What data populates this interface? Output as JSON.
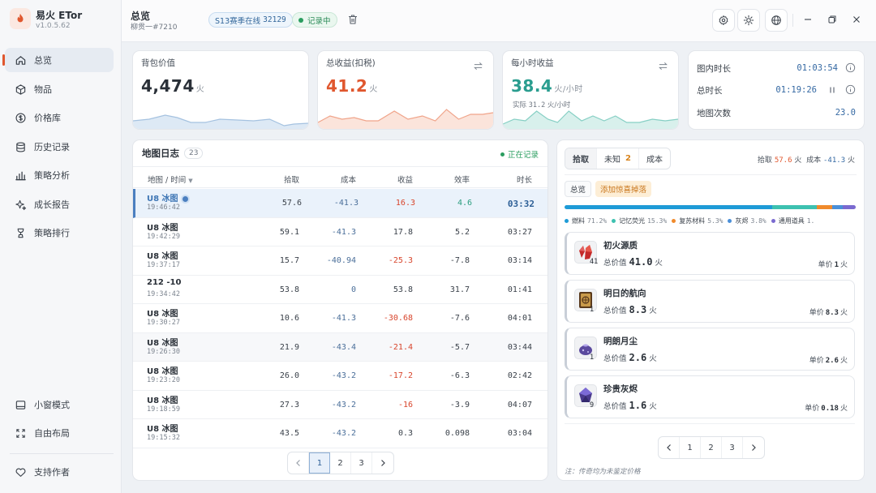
{
  "app": {
    "name": "易火 ETor",
    "version": "v1.0.5.62"
  },
  "nav": {
    "items": [
      {
        "label": "总览",
        "icon": "home-icon",
        "active": true
      },
      {
        "label": "物品",
        "icon": "box-icon"
      },
      {
        "label": "价格库",
        "icon": "coin-icon"
      },
      {
        "label": "历史记录",
        "icon": "database-icon"
      },
      {
        "label": "策略分析",
        "icon": "bar-chart-icon"
      },
      {
        "label": "成长报告",
        "icon": "sparkle-icon"
      },
      {
        "label": "策略排行",
        "icon": "trophy-icon"
      }
    ],
    "bottom": [
      {
        "label": "小窗模式",
        "icon": "window-icon"
      },
      {
        "label": "自由布局",
        "icon": "expand-icon"
      }
    ],
    "support": {
      "label": "支持作者",
      "icon": "heart-icon"
    }
  },
  "header": {
    "title": "总览",
    "subtitle": "柳贯一#7210",
    "season_label": "S13赛季在线",
    "season_count": "32129",
    "record_status": "记录中"
  },
  "stats": {
    "bag": {
      "title": "背包价值",
      "value": "4,474",
      "unit": "火"
    },
    "total_profit": {
      "title": "总收益(扣税)",
      "value": "41.2",
      "unit": "火"
    },
    "hourly": {
      "title": "每小时收益",
      "value": "38.4",
      "unit": "火/小时",
      "actual_prefix": "实际",
      "actual_value": "31.2",
      "actual_unit": "火/小时"
    },
    "times": {
      "map_time_label": "图内时长",
      "map_time": "01:03:54",
      "total_time_label": "总时长",
      "total_time": "01:19:26",
      "map_count_label": "地图次数",
      "map_count": "23.0"
    }
  },
  "colors": {
    "accent": "#e0572e",
    "profit": "#e0572e",
    "hourly": "#2a9d8f",
    "blue": "#3569a3"
  },
  "map_log": {
    "title": "地图日志",
    "count": "23",
    "status": "正在记录",
    "columns": {
      "map": "地图 / 时间",
      "pickup": "拾取",
      "cost": "成本",
      "profit": "收益",
      "efficiency": "效率",
      "duration": "时长"
    },
    "rows": [
      {
        "map": "U8 冰图",
        "time": "19:46:42",
        "pickup": "57.6",
        "cost": "-41.3",
        "profit": "16.3",
        "eff": "4.6",
        "dur": "03:32",
        "selected": true
      },
      {
        "map": "U8 冰图",
        "time": "19:42:29",
        "pickup": "59.1",
        "cost": "-41.3",
        "profit": "17.8",
        "eff": "5.2",
        "dur": "03:27"
      },
      {
        "map": "U8 冰图",
        "time": "19:37:17",
        "pickup": "15.7",
        "cost": "-40.94",
        "profit": "-25.3",
        "eff": "-7.8",
        "dur": "03:14"
      },
      {
        "map": "212 -10",
        "time": "19:34:42",
        "pickup": "53.8",
        "cost": "0",
        "profit": "53.8",
        "eff": "31.7",
        "dur": "01:41"
      },
      {
        "map": "U8 冰图",
        "time": "19:30:27",
        "pickup": "10.6",
        "cost": "-41.3",
        "profit": "-30.68",
        "eff": "-7.6",
        "dur": "04:01"
      },
      {
        "map": "U8 冰图",
        "time": "19:26:30",
        "pickup": "21.9",
        "cost": "-43.4",
        "profit": "-21.4",
        "eff": "-5.7",
        "dur": "03:44"
      },
      {
        "map": "U8 冰图",
        "time": "19:23:20",
        "pickup": "26.0",
        "cost": "-43.2",
        "profit": "-17.2",
        "eff": "-6.3",
        "dur": "02:42"
      },
      {
        "map": "U8 冰图",
        "time": "19:18:59",
        "pickup": "27.3",
        "cost": "-43.2",
        "profit": "-16",
        "eff": "-3.9",
        "dur": "04:07"
      },
      {
        "map": "U8 冰图",
        "time": "19:15:32",
        "pickup": "43.5",
        "cost": "-43.2",
        "profit": "0.3",
        "eff": "0.098",
        "dur": "03:04"
      }
    ],
    "pages": [
      "1",
      "2",
      "3"
    ],
    "current_page": "1"
  },
  "drops": {
    "tabs": [
      {
        "label": "拾取",
        "active": true
      },
      {
        "label": "未知",
        "badge": "2"
      },
      {
        "label": "成本"
      }
    ],
    "summary": {
      "pickup_label": "拾取",
      "pickup_value": "57.6",
      "cost_label": "成本",
      "cost_value": "-41.3",
      "unit": "火"
    },
    "subtabs": [
      "总览",
      "添加惊喜掉落"
    ],
    "breakdown": [
      {
        "label": "燃料",
        "pct": "71.2%",
        "share": 71.2,
        "color": "#1e9bd7"
      },
      {
        "label": "记忆荧光",
        "pct": "15.3%",
        "share": 15.3,
        "color": "#3dc1b0"
      },
      {
        "label": "复苏材料",
        "pct": "5.3%",
        "share": 5.3,
        "color": "#f08a2c"
      },
      {
        "label": "灰烬",
        "pct": "3.8%",
        "share": 3.8,
        "color": "#4a8fd8"
      },
      {
        "label": "通用道具",
        "pct": "1.",
        "share": 4.4,
        "color": "#7a6ad0"
      }
    ],
    "items": [
      {
        "name": "初火源质",
        "count": "41",
        "total_label": "总价值",
        "total": "41.0",
        "unit": "火",
        "unit_price_label": "单价",
        "unit_price": "1",
        "icon": "red-crystal-icon"
      },
      {
        "name": "明日的航向",
        "count": "1",
        "total_label": "总价值",
        "total": "8.3",
        "unit": "火",
        "unit_price_label": "单价",
        "unit_price": "8.3",
        "icon": "scroll-icon"
      },
      {
        "name": "明朗月尘",
        "count": "1",
        "total_label": "总价值",
        "total": "2.6",
        "unit": "火",
        "unit_price_label": "单价",
        "unit_price": "2.6",
        "icon": "dust-pouch-icon"
      },
      {
        "name": "珍贵灰烬",
        "count": "9",
        "total_label": "总价值",
        "total": "1.6",
        "unit": "火",
        "unit_price_label": "单价",
        "unit_price": "0.18",
        "icon": "purple-gem-icon"
      }
    ],
    "pages": [
      "1",
      "2",
      "3"
    ],
    "note": "注：传奇均为未鉴定价格"
  }
}
